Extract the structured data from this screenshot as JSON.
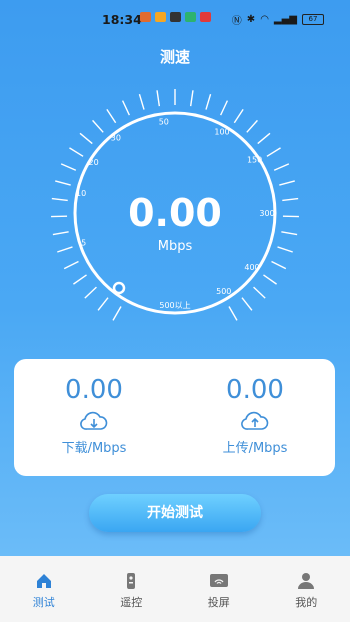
{
  "status": {
    "time": "18:34",
    "battery": "67"
  },
  "page_title": "测速",
  "gauge": {
    "value": "0.00",
    "unit": "Mbps",
    "tick_labels": [
      "5",
      "10",
      "20",
      "30",
      "50",
      "100",
      "150",
      "300",
      "400",
      "500",
      "500以上"
    ]
  },
  "download": {
    "value": "0.00",
    "label": "下载/Mbps"
  },
  "upload": {
    "value": "0.00",
    "label": "上传/Mbps"
  },
  "start_button": "开始测试",
  "nav": {
    "items": [
      {
        "label": "测试",
        "icon": "home-icon",
        "active": true
      },
      {
        "label": "遥控",
        "icon": "remote-icon",
        "active": false
      },
      {
        "label": "投屏",
        "icon": "cast-icon",
        "active": false
      },
      {
        "label": "我的",
        "icon": "user-icon",
        "active": false
      }
    ]
  }
}
